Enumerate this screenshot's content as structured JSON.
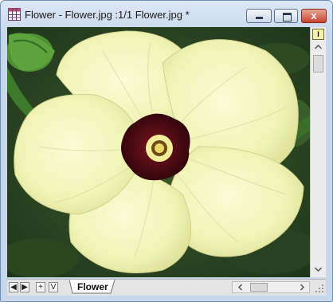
{
  "window": {
    "title": "Flower - Flower.jpg :1/1 Flower.jpg *",
    "controls": [
      "minimize",
      "maximize",
      "close"
    ],
    "close_glyph": "x"
  },
  "image": {
    "description_icon": "flower-photo",
    "colors": {
      "petal": "#f3f4bc",
      "center": "#4a0a12",
      "background": "#2f4a24"
    }
  },
  "vscroll": {
    "marker_label": "I"
  },
  "bottom": {
    "nav": [
      "◀",
      "▶",
      "+",
      "V"
    ],
    "sheet_tab": "Flower"
  },
  "colors": {
    "titlebar": "#dde8f5",
    "close": "#c7442d",
    "frame": "#6f8fb5"
  }
}
